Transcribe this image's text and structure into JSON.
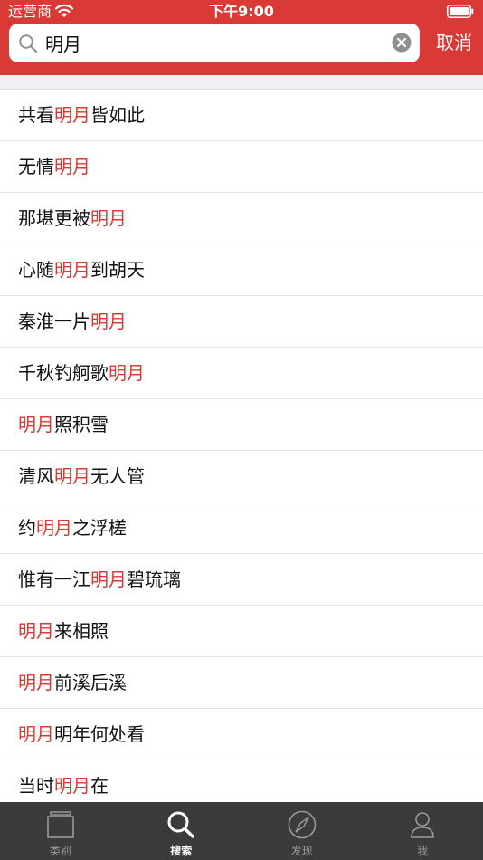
{
  "status_bar": {
    "carrier": "运营商",
    "time": "下午9:00"
  },
  "search": {
    "query": "明月",
    "cancel_label": "取消"
  },
  "results": [
    {
      "before": "共看",
      "match": "明月",
      "after": "皆如此"
    },
    {
      "before": "无情",
      "match": "明月",
      "after": ""
    },
    {
      "before": "那堪更被",
      "match": "明月",
      "after": ""
    },
    {
      "before": "心随",
      "match": "明月",
      "after": "到胡天"
    },
    {
      "before": "秦淮一片",
      "match": "明月",
      "after": ""
    },
    {
      "before": "千秋钓舸歌",
      "match": "明月",
      "after": ""
    },
    {
      "before": "",
      "match": "明月",
      "after": "照积雪"
    },
    {
      "before": "清风",
      "match": "明月",
      "after": "无人管"
    },
    {
      "before": "约",
      "match": "明月",
      "after": "之浮槎"
    },
    {
      "before": "惟有一江",
      "match": "明月",
      "after": "碧琉璃"
    },
    {
      "before": "",
      "match": "明月",
      "after": "来相照"
    },
    {
      "before": "",
      "match": "明月",
      "after": "前溪后溪"
    },
    {
      "before": "",
      "match": "明月",
      "after": "明年何处看"
    },
    {
      "before": "当时",
      "match": "明月",
      "after": "在"
    }
  ],
  "tabs": [
    {
      "label": "类别",
      "icon": "category-icon",
      "active": false
    },
    {
      "label": "搜索",
      "icon": "search-icon",
      "active": true
    },
    {
      "label": "发现",
      "icon": "compass-icon",
      "active": false
    },
    {
      "label": "我",
      "icon": "person-icon",
      "active": false
    }
  ],
  "colors": {
    "accent": "#d93a35",
    "tab_bar": "#3b3b3b",
    "tab_inactive": "#9a9a9a"
  }
}
